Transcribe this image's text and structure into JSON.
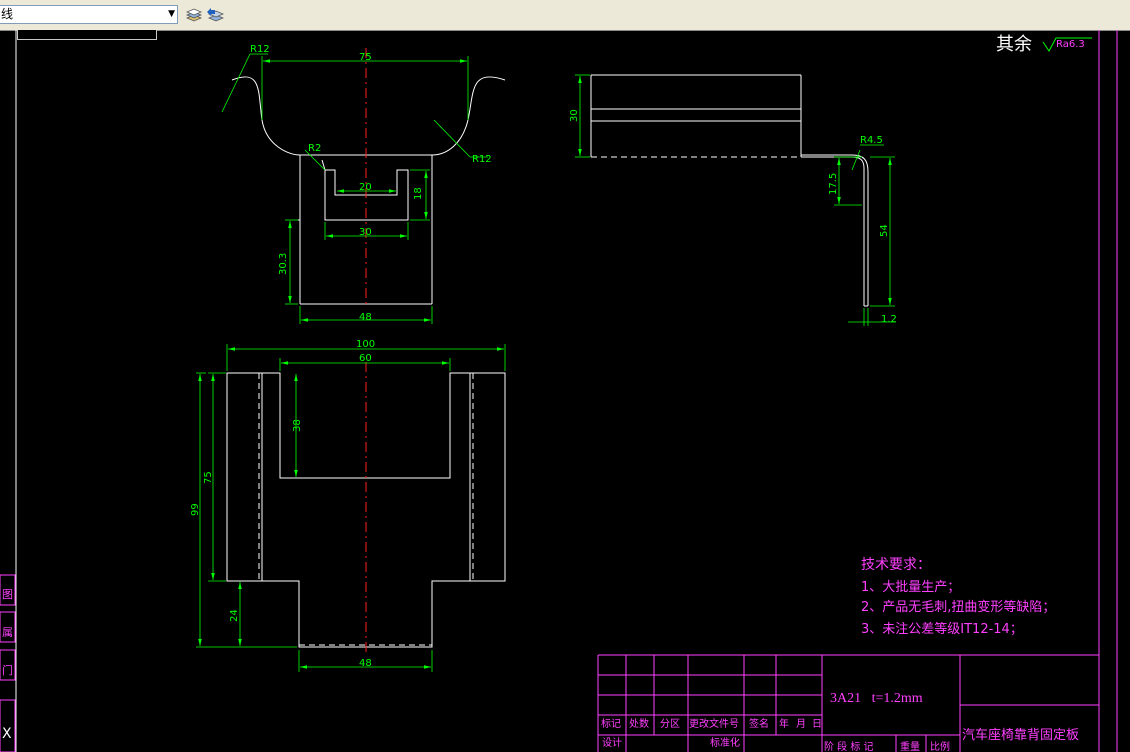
{
  "toolbar": {
    "layer_value": "线",
    "layer_icon": "layer-stack-icon",
    "layer_prev_icon": "layer-previous-icon"
  },
  "roughness": {
    "prefix": "其余",
    "value": "Ra6.3"
  },
  "dims": {
    "top_width": "75",
    "radius_left": "R12",
    "radius_right": "R12",
    "radius_small": "R2",
    "slot_inner": "20",
    "slot_outer": "30",
    "slot_depth": "18",
    "lower_height": "30.3",
    "base_width": "48",
    "side_height": "30",
    "bend_radius": "R4.5",
    "flange": "17.5",
    "leg": "54",
    "thickness": "1.2",
    "flat_total": "100",
    "cutout_width": "60",
    "cutout_depth": "38",
    "flat_height_75": "75",
    "flat_height_99": "99",
    "tab_height": "24",
    "tab_width": "48"
  },
  "tech": {
    "title": "技术要求：",
    "items": [
      "1、大批量生产；",
      "2、产品无毛刺,扭曲变形等缺陷；",
      "3、未注公差等级IT12-14；"
    ]
  },
  "titleblock": {
    "material": "3A21   t=1.2mm",
    "name": "汽车座椅靠背固定板",
    "headers": [
      "标记",
      "处数",
      "分区",
      "更改文件号",
      "签名",
      "年",
      "月",
      "日"
    ],
    "row2": [
      "设计",
      "标准化"
    ],
    "stage": "阶 段 标 记",
    "weight": "重量",
    "scale": "比例"
  },
  "sidebar_tabs": [
    "图",
    "属",
    "门",
    "X"
  ],
  "colors": {
    "outline": "#ffffff",
    "dim": "#00ff00",
    "center": "#ff2020",
    "text": "#ff40ff",
    "block": "#ff40ff"
  }
}
